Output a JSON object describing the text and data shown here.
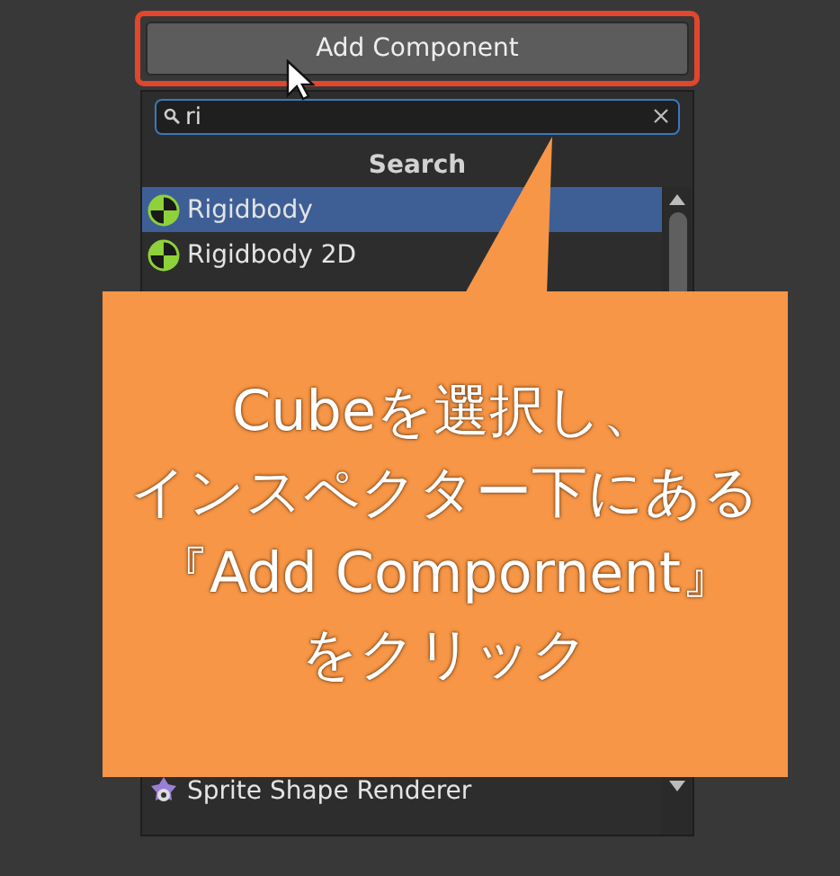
{
  "add_button": {
    "label": "Add Component",
    "highlighted": true
  },
  "search": {
    "value": "ri"
  },
  "list_header": "Search",
  "results_top": [
    {
      "label": "Rigidbody",
      "kind": "physics",
      "selected": true
    },
    {
      "label": "Rigidbody 2D",
      "kind": "physics",
      "selected": false
    }
  ],
  "results_bottom": [
    {
      "label": "Sprite Shape Renderer",
      "kind": "sprite",
      "selected": false
    }
  ],
  "callout": {
    "lines": [
      "Cubeを選択し、",
      "インスペクター下にある",
      "『Add  Compornent』",
      "をクリック"
    ]
  }
}
